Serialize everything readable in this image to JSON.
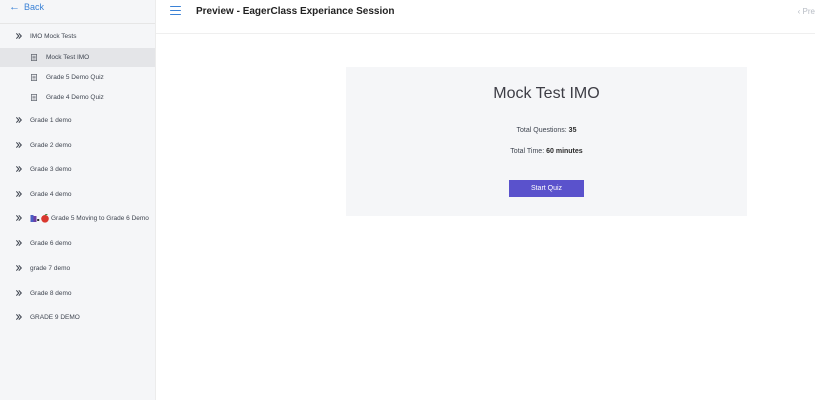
{
  "sidebar": {
    "back_label": "Back",
    "section": {
      "label": "IMO Mock Tests"
    },
    "sub_items": [
      {
        "label": "Mock Test IMO",
        "active": true
      },
      {
        "label": "Grade 5 Demo Quiz",
        "active": false
      },
      {
        "label": "Grade 4 Demo Quiz",
        "active": false
      }
    ],
    "items": [
      {
        "label": "Grade 1 demo"
      },
      {
        "label": "Grade 2 demo"
      },
      {
        "label": "Grade 3 demo"
      },
      {
        "label": "Grade 4 demo"
      },
      {
        "label": "Grade 5 Moving to Grade 6 Demo"
      },
      {
        "label": "Grade 6 demo"
      },
      {
        "label": "grade 7 demo"
      },
      {
        "label": "Grade 8 demo"
      },
      {
        "label": "GRADE 9 DEMO"
      }
    ]
  },
  "header": {
    "title": "Preview - EagerClass Experiance Session",
    "prev_label": "Pre"
  },
  "quiz": {
    "title": "Mock Test IMO",
    "questions_label": "Total Questions:",
    "questions_value": "35",
    "time_label": "Total Time:",
    "time_value": "60 minutes",
    "start_label": "Start Quiz"
  },
  "colors": {
    "accent": "#3b82d6",
    "button": "#5a52cc"
  }
}
